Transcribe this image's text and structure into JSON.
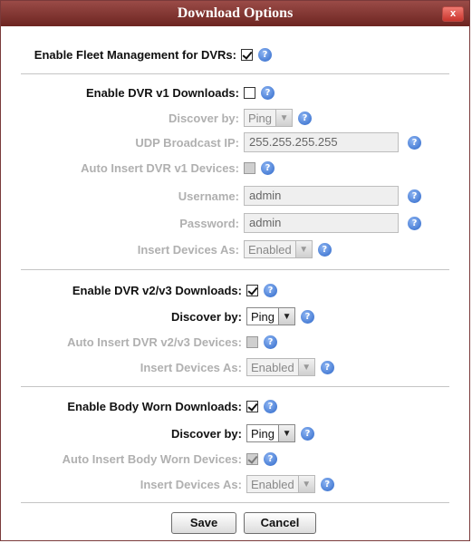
{
  "dialog": {
    "title": "Download Options",
    "close_label": "x"
  },
  "fleet": {
    "label": "Enable Fleet Management for DVRs:",
    "checked": true
  },
  "dvr_v1": {
    "enable_label": "Enable DVR v1 Downloads:",
    "enable_checked": false,
    "discover_label": "Discover by:",
    "discover_value": "Ping",
    "udp_label": "UDP Broadcast IP:",
    "udp_value": "255.255.255.255",
    "auto_insert_label": "Auto Insert DVR v1 Devices:",
    "auto_insert_checked": false,
    "username_label": "Username:",
    "username_value": "admin",
    "password_label": "Password:",
    "password_value": "admin",
    "insert_as_label": "Insert Devices As:",
    "insert_as_value": "Enabled"
  },
  "dvr_v23": {
    "enable_label": "Enable DVR v2/v3 Downloads:",
    "enable_checked": true,
    "discover_label": "Discover by:",
    "discover_value": "Ping",
    "auto_insert_label": "Auto Insert DVR v2/v3 Devices:",
    "auto_insert_checked": false,
    "insert_as_label": "Insert Devices As:",
    "insert_as_value": "Enabled"
  },
  "body_worn": {
    "enable_label": "Enable Body Worn Downloads:",
    "enable_checked": true,
    "discover_label": "Discover by:",
    "discover_value": "Ping",
    "auto_insert_label": "Auto Insert Body Worn Devices:",
    "auto_insert_checked": true,
    "insert_as_label": "Insert Devices As:",
    "insert_as_value": "Enabled"
  },
  "buttons": {
    "save": "Save",
    "cancel": "Cancel"
  },
  "help_glyph": "?",
  "dropdown_glyph": "▼",
  "colors": {
    "title_bar": "#7d322e",
    "help_icon": "#2d67c9",
    "disabled_text": "#b0b0b0"
  }
}
